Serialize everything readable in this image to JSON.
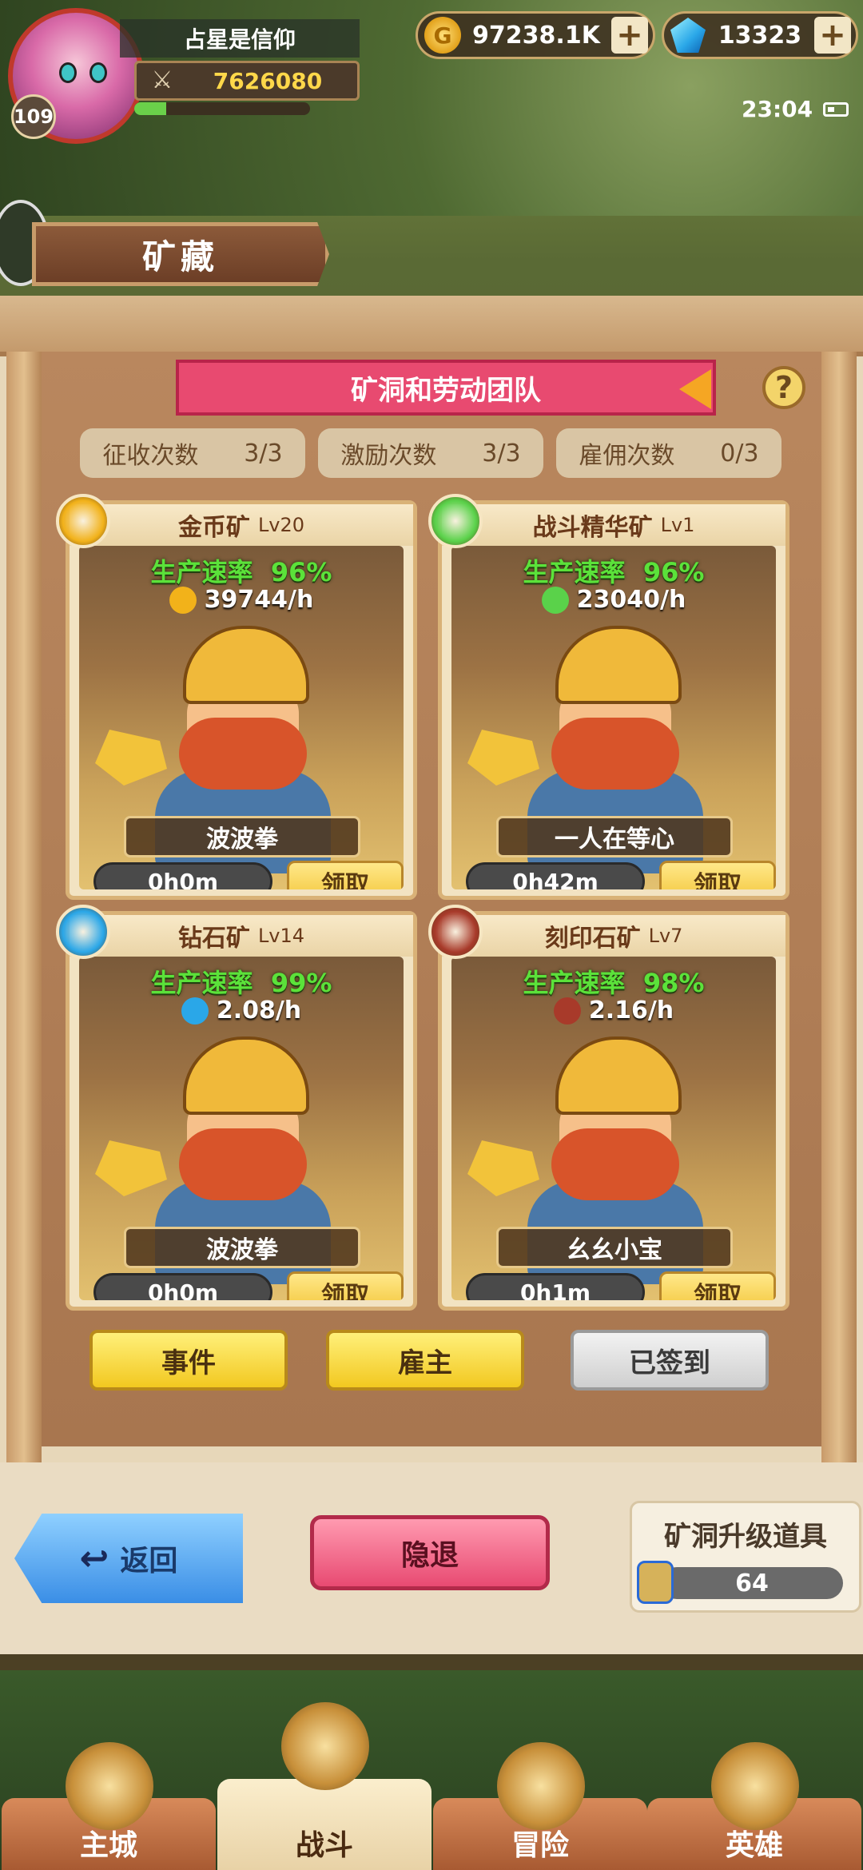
{
  "player": {
    "name": "占星是信仰",
    "level": "109",
    "power": "7626080",
    "exp_fraction": 0.18
  },
  "resources": {
    "gold": "97238.1K",
    "gems": "13323",
    "plus": "+"
  },
  "status": {
    "time": "23:04"
  },
  "title": "矿藏",
  "panel": {
    "ribbon_title": "矿洞和劳动团队",
    "help": "?",
    "counters": [
      {
        "label": "征收次数",
        "value": "3/3"
      },
      {
        "label": "激励次数",
        "value": "3/3"
      },
      {
        "label": "雇佣次数",
        "value": "0/3"
      }
    ]
  },
  "mines": [
    {
      "name": "金币矿",
      "level": "Lv20",
      "rate_label": "生产速率",
      "rate": "96%",
      "output": "39744/h",
      "worker": "波波拳",
      "timer": "0h0m",
      "claim": "领取",
      "icon": "gold-coin-icon",
      "color": "#f2b21a"
    },
    {
      "name": "战斗精华矿",
      "level": "Lv1",
      "rate_label": "生产速率",
      "rate": "96%",
      "output": "23040/h",
      "worker": "一人在等心",
      "timer": "0h42m",
      "claim": "领取",
      "icon": "potion-icon",
      "color": "#5ad24a"
    },
    {
      "name": "钻石矿",
      "level": "Lv14",
      "rate_label": "生产速率",
      "rate": "99%",
      "output": "2.08/h",
      "worker": "波波拳",
      "timer": "0h0m",
      "claim": "领取",
      "icon": "diamond-icon",
      "color": "#2aa7e8"
    },
    {
      "name": "刻印石矿",
      "level": "Lv7",
      "rate_label": "生产速率",
      "rate": "98%",
      "output": "2.16/h",
      "worker": "幺幺小宝",
      "timer": "0h1m",
      "claim": "领取",
      "icon": "seal-stone-icon",
      "color": "#a83a2a"
    }
  ],
  "actions": {
    "event": "事件",
    "employer": "雇主",
    "signed": "已签到"
  },
  "bottom": {
    "back": "返回",
    "retire": "隐退",
    "upgrade_title": "矿洞升级道具",
    "upgrade_count": "64"
  },
  "nav": [
    {
      "label": "主城",
      "icon": "castle-icon"
    },
    {
      "label": "战斗",
      "icon": "crossed-swords-icon",
      "active": true
    },
    {
      "label": "冒险",
      "icon": "scroll-map-icon"
    },
    {
      "label": "英雄",
      "icon": "hero-crest-icon"
    }
  ]
}
